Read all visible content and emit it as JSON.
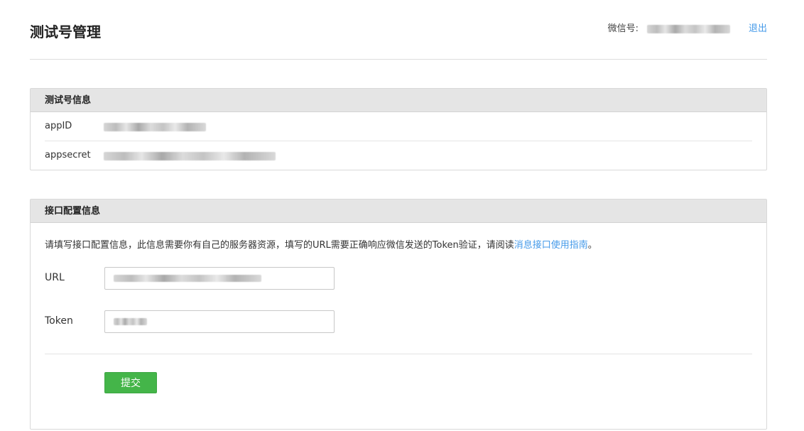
{
  "header": {
    "title": "测试号管理",
    "wechat_id_label": "微信号:",
    "logout_label": "退出"
  },
  "test_account_panel": {
    "title": "测试号信息",
    "rows": [
      {
        "key": "appID"
      },
      {
        "key": "appsecret"
      }
    ]
  },
  "interface_panel": {
    "title": "接口配置信息",
    "description_prefix": "请填写接口配置信息，此信息需要你有自己的服务器资源，填写的URL需要正确响应微信发送的Token验证，请阅读",
    "guide_link": "消息接口使用指南",
    "description_suffix": "。",
    "url_label": "URL",
    "token_label": "Token",
    "submit_label": "提交"
  },
  "colors": {
    "link": "#459ae9",
    "submit_green": "#44b549",
    "panel_header_bg": "#e5e5e5"
  }
}
